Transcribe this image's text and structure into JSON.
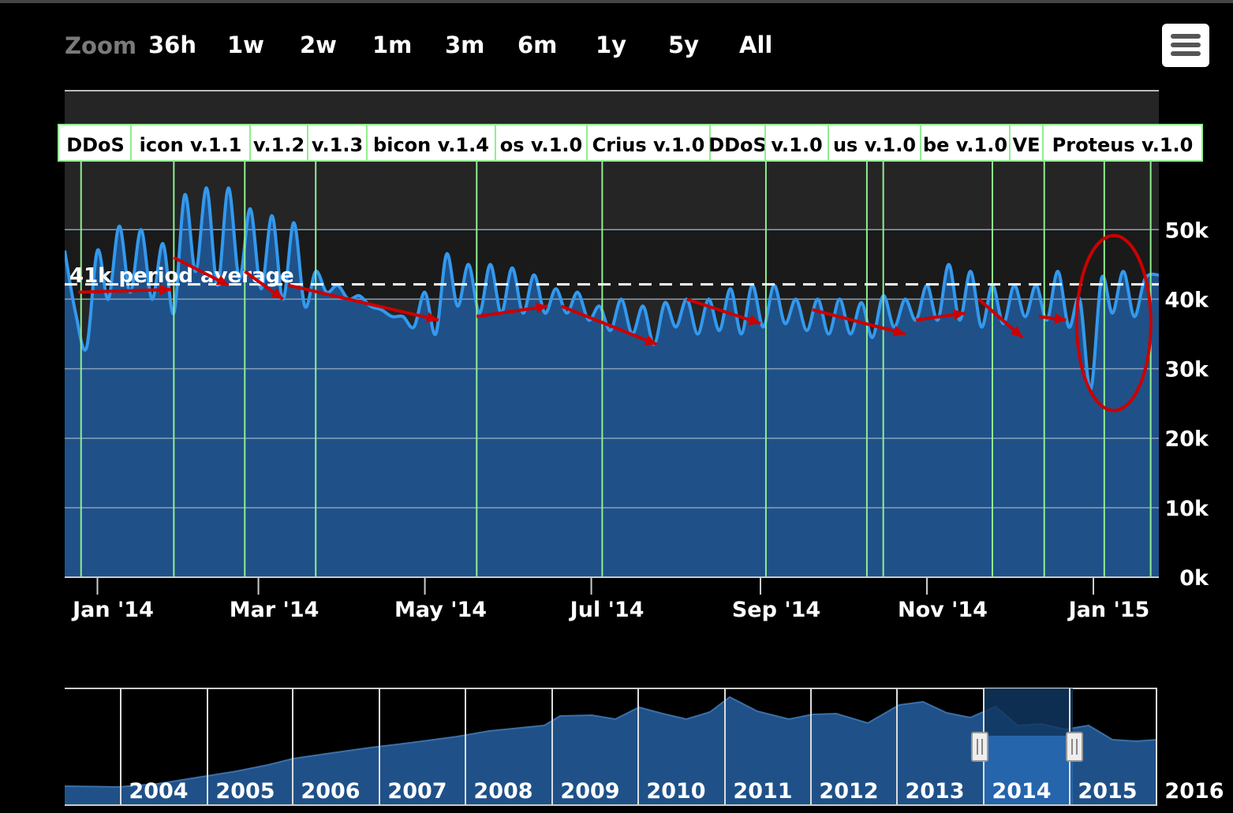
{
  "toolbar": {
    "zoom_label": "Zoom",
    "buttons": [
      "36h",
      "1w",
      "2w",
      "1m",
      "3m",
      "6m",
      "1y",
      "5y",
      "All"
    ]
  },
  "colors": {
    "series_line": "#3399ee",
    "area_fill": "#1f5188",
    "flag_line": "#90ee90",
    "arrow": "#cc0000",
    "average_line": "#ffffff"
  },
  "chart_data": {
    "type": "area",
    "ylim": [
      0,
      60000
    ],
    "yticks": [
      "0k",
      "10k",
      "20k",
      "30k",
      "40k",
      "50k"
    ],
    "xticks": [
      "Jan '14",
      "Mar '14",
      "May '14",
      "Jul '14",
      "Sep '14",
      "Nov '14",
      "Jan '15"
    ],
    "x_range": [
      "2013-12-20",
      "2015-01-25"
    ],
    "average": {
      "value": 41000,
      "label": "41k period average"
    },
    "flags": [
      "DDoS",
      "icon v.1.1",
      "v.1.2",
      "v.1.3",
      "bicon v.1.4",
      "os v.1.0",
      "Crius v.1.0",
      "DDoS",
      "v.1.0",
      "us v.1.0",
      "be v.1.0",
      "VE",
      "Proteus v.1.0"
    ],
    "flag_dates": [
      "2013-12-26",
      "2014-01-29",
      "2014-02-24",
      "2014-03-22",
      "2014-05-20",
      "2014-07-05",
      "2014-09-03",
      "2014-10-10",
      "2014-10-16",
      "2014-11-25",
      "2015-01-05",
      "2014-12-14",
      "2015-01-22"
    ],
    "trend_arrows": [
      {
        "from": [
          "2013-12-25",
          41000
        ],
        "to": [
          "2014-01-28",
          41400
        ]
      },
      {
        "from": [
          "2014-01-29",
          46000
        ],
        "to": [
          "2014-02-18",
          42000
        ]
      },
      {
        "from": [
          "2014-02-24",
          44000
        ],
        "to": [
          "2014-03-10",
          40000
        ]
      },
      {
        "from": [
          "2014-03-12",
          42000
        ],
        "to": [
          "2014-05-06",
          37000
        ]
      },
      {
        "from": [
          "2014-05-20",
          37500
        ],
        "to": [
          "2014-06-15",
          39000
        ]
      },
      {
        "from": [
          "2014-06-20",
          39000
        ],
        "to": [
          "2014-07-25",
          33500
        ]
      },
      {
        "from": [
          "2014-08-05",
          40000
        ],
        "to": [
          "2014-09-01",
          36500
        ]
      },
      {
        "from": [
          "2014-09-20",
          38500
        ],
        "to": [
          "2014-10-24",
          35000
        ]
      },
      {
        "from": [
          "2014-10-28",
          37000
        ],
        "to": [
          "2014-11-15",
          38000
        ]
      },
      {
        "from": [
          "2014-11-20",
          40000
        ],
        "to": [
          "2014-12-06",
          34500
        ]
      },
      {
        "from": [
          "2014-12-12",
          37500
        ],
        "to": [
          "2014-12-22",
          37000
        ]
      }
    ],
    "highlight_ellipse": {
      "center": [
        "2015-01-05",
        36000
      ],
      "label": ""
    },
    "series": [
      {
        "x": [
          "2013-12-20",
          "2013-12-24",
          "2013-12-28",
          "2014-01-01",
          "2014-01-05",
          "2014-01-09",
          "2014-01-13",
          "2014-01-17",
          "2014-01-21",
          "2014-01-25",
          "2014-01-29",
          "2014-02-02",
          "2014-02-06",
          "2014-02-10",
          "2014-02-14",
          "2014-02-18",
          "2014-02-22",
          "2014-02-26",
          "2014-03-02",
          "2014-03-06",
          "2014-03-10",
          "2014-03-14",
          "2014-03-18",
          "2014-03-22",
          "2014-03-26",
          "2014-03-30",
          "2014-04-03",
          "2014-04-07",
          "2014-04-11",
          "2014-04-15",
          "2014-04-19",
          "2014-04-23",
          "2014-04-27",
          "2014-05-01",
          "2014-05-05",
          "2014-05-09",
          "2014-05-13",
          "2014-05-17",
          "2014-05-21",
          "2014-05-25",
          "2014-05-29",
          "2014-06-02",
          "2014-06-06",
          "2014-06-10",
          "2014-06-14",
          "2014-06-18",
          "2014-06-22",
          "2014-06-26",
          "2014-06-30",
          "2014-07-04",
          "2014-07-08",
          "2014-07-12",
          "2014-07-16",
          "2014-07-20",
          "2014-07-24",
          "2014-07-28",
          "2014-08-01",
          "2014-08-05",
          "2014-08-09",
          "2014-08-13",
          "2014-08-17",
          "2014-08-21",
          "2014-08-25",
          "2014-08-29",
          "2014-09-02",
          "2014-09-06",
          "2014-09-10",
          "2014-09-14",
          "2014-09-18",
          "2014-09-22",
          "2014-09-26",
          "2014-09-30",
          "2014-10-04",
          "2014-10-08",
          "2014-10-12",
          "2014-10-16",
          "2014-10-20",
          "2014-10-24",
          "2014-10-28",
          "2014-11-01",
          "2014-11-05",
          "2014-11-09",
          "2014-11-13",
          "2014-11-17",
          "2014-11-21",
          "2014-11-25",
          "2014-11-29",
          "2014-12-03",
          "2014-12-07",
          "2014-12-11",
          "2014-12-15",
          "2014-12-19",
          "2014-12-23",
          "2014-12-27",
          "2014-12-31",
          "2015-01-04",
          "2015-01-08",
          "2015-01-12",
          "2015-01-16",
          "2015-01-20",
          "2015-01-25"
        ],
        "y": [
          47000,
          38000,
          33000,
          47000,
          40000,
          50500,
          41000,
          50000,
          40000,
          48000,
          38000,
          55000,
          44000,
          56000,
          42000,
          56000,
          43000,
          53000,
          41500,
          52000,
          40000,
          51000,
          39000,
          44000,
          41000,
          42000,
          40000,
          40500,
          39000,
          38500,
          37500,
          37500,
          36000,
          41000,
          35000,
          46500,
          39000,
          45000,
          38000,
          45000,
          38000,
          44500,
          38000,
          43500,
          38000,
          41500,
          38000,
          41000,
          37000,
          39000,
          35500,
          40000,
          35000,
          39000,
          33500,
          39500,
          36000,
          40000,
          35000,
          40000,
          35500,
          41500,
          35000,
          42000,
          36000,
          42000,
          36500,
          40000,
          35500,
          40000,
          35000,
          40000,
          35000,
          39500,
          34500,
          40500,
          36000,
          40000,
          37000,
          42000,
          37000,
          45000,
          37000,
          44000,
          36000,
          42000,
          36500,
          42000,
          37500,
          42000,
          37000,
          44000,
          36000,
          40000,
          27000,
          43000,
          38000,
          44000,
          37500,
          43000,
          43500
        ]
      }
    ]
  },
  "navigator": {
    "years": [
      "2004",
      "2005",
      "2006",
      "2007",
      "2008",
      "2009",
      "2010",
      "2011",
      "2012",
      "2013",
      "2014",
      "2015",
      "2016"
    ]
  }
}
